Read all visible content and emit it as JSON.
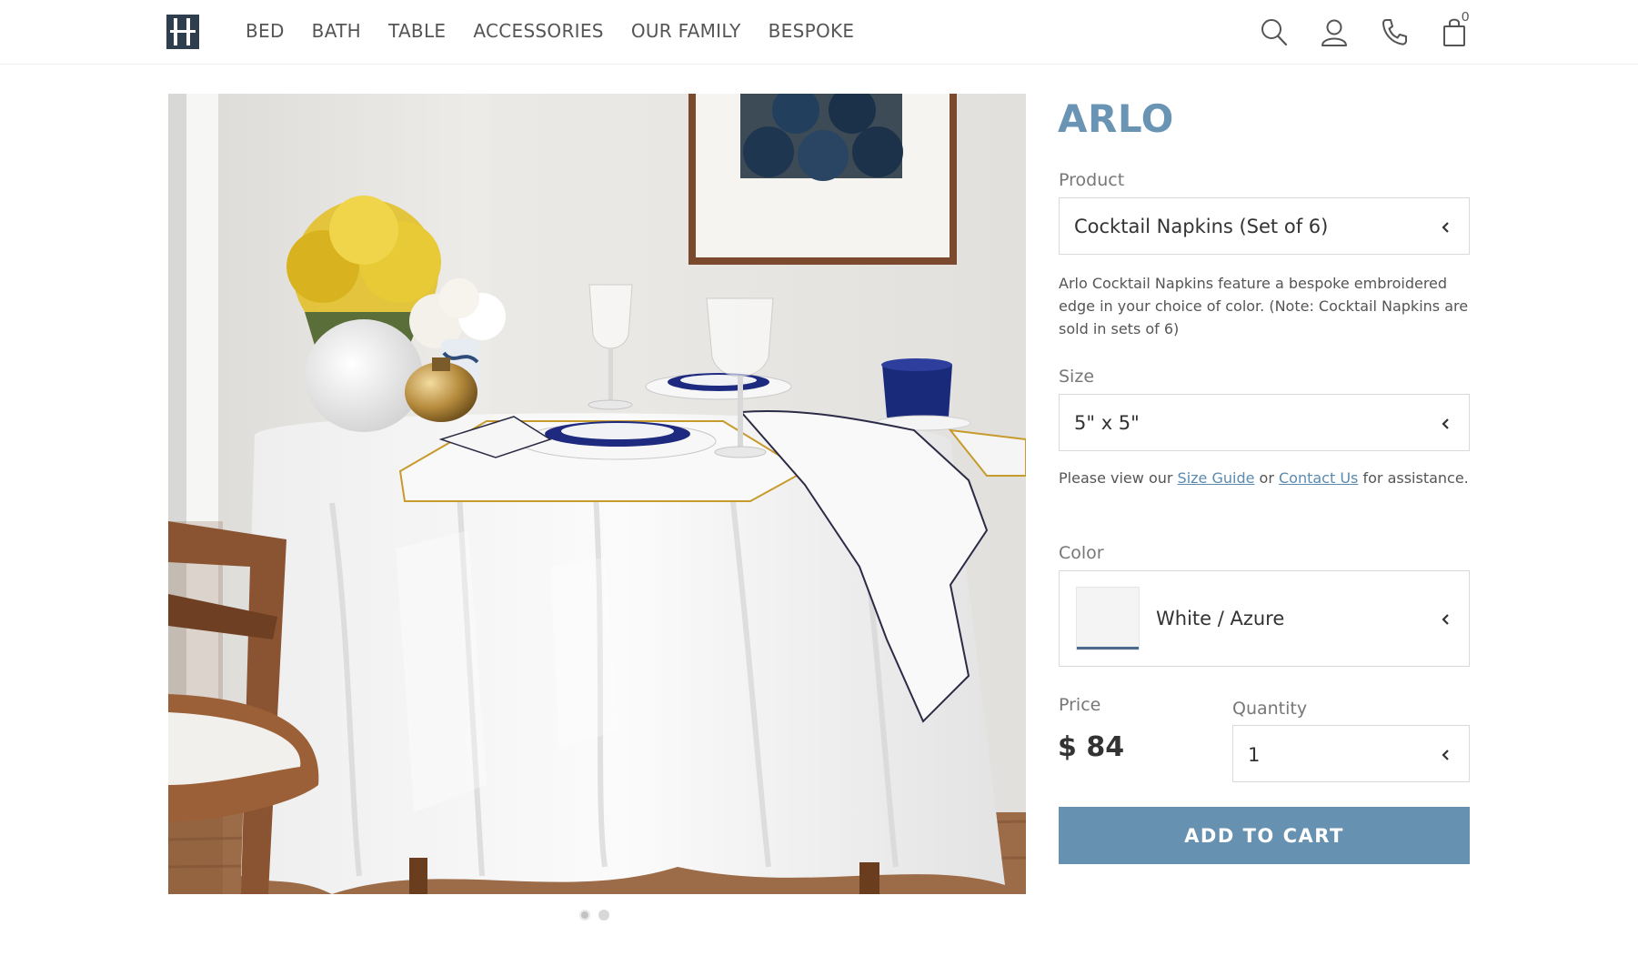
{
  "nav": {
    "items": [
      "BED",
      "BATH",
      "TABLE",
      "ACCESSORIES",
      "OUR FAMILY",
      "BESPOKE"
    ],
    "cart_count": "0"
  },
  "product": {
    "title": "ARLO",
    "product_label": "Product",
    "product_value": "Cocktail Napkins (Set of 6)",
    "description": "Arlo Cocktail Napkins feature a bespoke embroidered edge in your choice of color. (Note: Cocktail Napkins are sold in sets of 6)",
    "size_label": "Size",
    "size_value": "5\" x 5\"",
    "help_prefix": "Please view our ",
    "size_guide": "Size Guide",
    "help_mid": " or ",
    "contact_us": "Contact Us",
    "help_suffix": " for assistance.",
    "color_label": "Color",
    "color_value": "White / Azure",
    "price_label": "Price",
    "price": "$ 84",
    "quantity_label": "Quantity",
    "quantity": "1",
    "add_to_cart": "ADD TO CART"
  },
  "gallery": {
    "slides": 2,
    "active": 1
  },
  "colors": {
    "accent": "#6791b1",
    "title": "#6a94b4",
    "link": "#5a8ab0",
    "logo": "#2e3e4e",
    "swatch_trim": "#4a6b8e"
  }
}
